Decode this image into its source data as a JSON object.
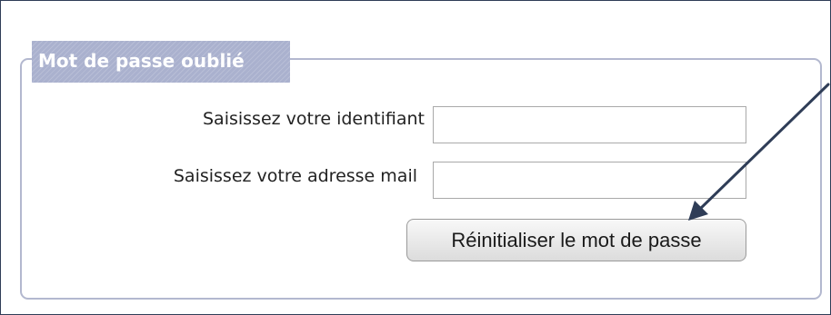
{
  "form": {
    "legend": "Mot de passe oublié",
    "fields": [
      {
        "label": "Saisissez votre identifiant",
        "value": "",
        "placeholder": ""
      },
      {
        "label": "Saisissez votre adresse mail",
        "value": "",
        "placeholder": ""
      }
    ],
    "submit_label": "Réinitialiser le mot de passe"
  },
  "annotation": {
    "arrow_color": "#2f3d57"
  },
  "colors": {
    "legend_background": "#aab1ce",
    "fieldset_border": "#b3b8cf",
    "frame_border": "#2f3d57"
  }
}
